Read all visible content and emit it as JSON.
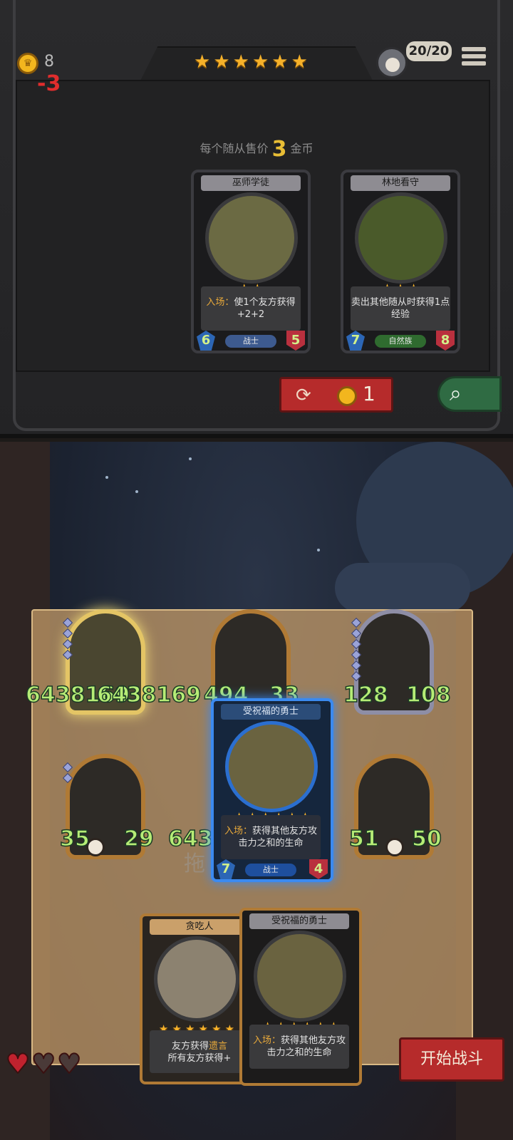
{
  "header": {
    "gold": "8",
    "gold_delta": "-3",
    "tier_stars": [
      "★",
      "★",
      "★",
      "★",
      "★",
      "★"
    ],
    "health_display": "20/20",
    "menu_icon": "menu-icon"
  },
  "shop": {
    "sell_prefix": "每个随从售价",
    "sell_price": "3",
    "sell_suffix": "金币",
    "cards": [
      {
        "name": "巫师学徒",
        "stars": [
          "★",
          "★"
        ],
        "desc_keyword": "入场：",
        "desc": "使1个友方获得+2+2",
        "attack": "6",
        "health": "5",
        "tribe": "战士",
        "tribe_color": "#3d5a8f",
        "portrait_color": "#6b6a43"
      },
      {
        "name": "林地看守",
        "stars": [
          "★",
          "★",
          "★"
        ],
        "desc_keyword": "",
        "desc": "卖出其他随从时获得1点经验",
        "attack": "7",
        "health": "8",
        "tribe": "自然族",
        "tribe_color": "#2f6b2f",
        "portrait_color": "#4a5a2a"
      }
    ],
    "refresh_cost": "1",
    "refresh_icon": "refresh-icon",
    "search_icon": "search-icon"
  },
  "board": {
    "units": [
      {
        "attack": "6438169",
        "health": "6438169",
        "tier": "gold",
        "pips": 4
      },
      {
        "attack": "494",
        "health": "33",
        "tier": "bronze",
        "pips": 0
      },
      {
        "attack": "128",
        "health": "108",
        "tier": "silver",
        "pips": 6
      },
      {
        "attack": "35",
        "health": "29",
        "tier": "bronze",
        "pips": 2
      },
      {
        "attack": "51",
        "health": "50",
        "tier": "bronze",
        "pips": 0
      }
    ],
    "overlap_stat": "643",
    "drag_hint": "拖"
  },
  "selected_card": {
    "name": "受祝福的勇士",
    "stars": [
      "★",
      "★",
      "★",
      "★",
      "★",
      "★"
    ],
    "desc_keyword": "入场：",
    "desc": "获得其他友方攻击力之和的生命",
    "attack": "7",
    "health": "4",
    "tribe": "战士"
  },
  "hand": [
    {
      "name": "贪吃人",
      "stars": [
        "★",
        "★",
        "★",
        "★",
        "★",
        "★"
      ],
      "desc_a": "友方获得",
      "desc_kw": "遗言",
      "desc_b": "所有友方获得+"
    },
    {
      "name": "受祝福的勇士",
      "stars": [
        "★",
        "★",
        "★",
        "★",
        "★",
        "★"
      ],
      "desc_keyword": "入场：",
      "desc": "获得其他友方攻击力之和的生命"
    }
  ],
  "lives": {
    "filled": 1,
    "total": 3
  },
  "fight_button": "开始战斗",
  "colors": {
    "gold": "#f5b12a",
    "stat_green": "#b6ec76",
    "button_red": "#b62b2b"
  }
}
